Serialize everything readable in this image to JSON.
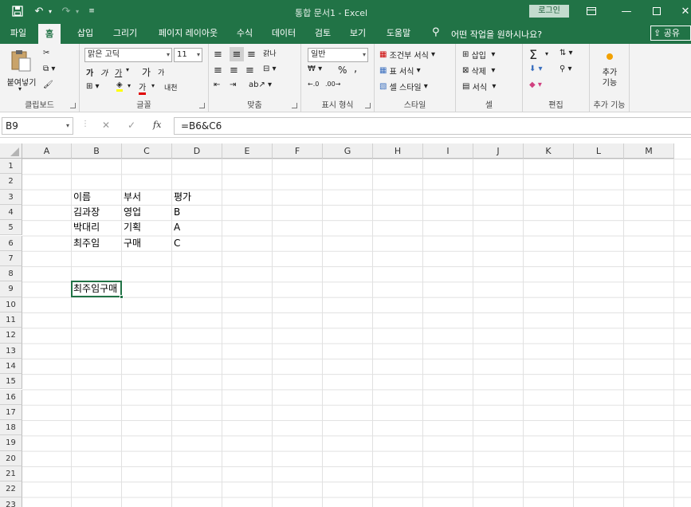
{
  "title_bar": {
    "title": "통합 문서1  -  Excel",
    "login_label": "로그인",
    "window_controls": [
      "minimize-icon",
      "maximize-icon",
      "close-icon"
    ]
  },
  "ribbon_tabs": [
    "파일",
    "홈",
    "삽입",
    "그리기",
    "페이지 레이아웃",
    "수식",
    "데이터",
    "검토",
    "보기",
    "도움말"
  ],
  "active_tab": "홈",
  "tell_me": "어떤 작업을 원하시나요?",
  "share_label": "공유",
  "ribbon": {
    "clipboard": {
      "paste": "붙여넣기",
      "label": "클립보드"
    },
    "font": {
      "name": "맑은 고딕",
      "size": "11",
      "bold": "가",
      "italic": "가",
      "underline": "가",
      "grow": "가",
      "shrink": "가",
      "color": "가",
      "phonetic": "내천",
      "label": "글꼴"
    },
    "alignment": {
      "wrap": "갉나",
      "label": "맞춤"
    },
    "number": {
      "format": "일반",
      "percent": "%",
      "comma": ",",
      "label": "표시 형식"
    },
    "styles": {
      "conditional": "조건부 서식",
      "table": "표 서식",
      "cell": "셀 스타일",
      "label": "스타일"
    },
    "cells": {
      "insert": "삽입",
      "delete": "삭제",
      "format": "서식",
      "label": "셀"
    },
    "editing": {
      "label": "편집"
    },
    "addins": {
      "button": "추가\n기능",
      "label": "추가 기능"
    }
  },
  "formula_bar": {
    "name_box": "B9",
    "formula": "=B6&C6",
    "fx": "fx"
  },
  "colors": {
    "accent": "#217346",
    "active_cell": "#217346"
  },
  "columns": [
    "A",
    "B",
    "C",
    "D",
    "E",
    "F",
    "G",
    "H",
    "I",
    "J",
    "K",
    "L",
    "M"
  ],
  "rows": [
    "1",
    "2",
    "3",
    "4",
    "5",
    "6",
    "7",
    "8",
    "9",
    "10",
    "11",
    "12",
    "13",
    "14",
    "15",
    "16",
    "17",
    "18",
    "19",
    "20",
    "21",
    "22",
    "23"
  ],
  "cells": {
    "B3": "이름",
    "C3": "부서",
    "D3": "평가",
    "B4": "김과장",
    "C4": "영업",
    "D4": "B",
    "B5": "박대리",
    "C5": "기획",
    "D5": "A",
    "B6": "최주임",
    "C6": "구매",
    "D6": "C",
    "B9": "최주임구매"
  },
  "selected_cell": "B9"
}
